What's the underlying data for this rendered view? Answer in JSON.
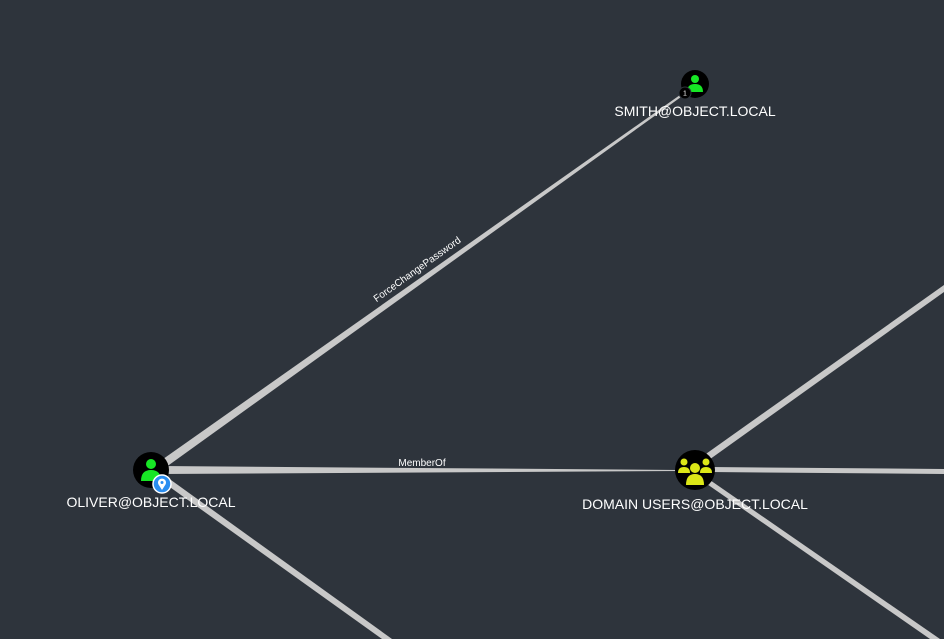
{
  "colors": {
    "background": "#2e343c",
    "edge": "#c8c8c8",
    "node_ring": "#000000",
    "user_icon": "#17e625",
    "group_icon": "#dbe617",
    "owned_marker": "#2b8ef0",
    "label": "#ffffff"
  },
  "nodes": {
    "smith": {
      "label": "SMITH@OBJECT.LOCAL",
      "type": "user",
      "icon": "user-icon",
      "badge": "1"
    },
    "oliver": {
      "label": "OLIVER@OBJECT.LOCAL",
      "type": "user",
      "icon": "user-icon",
      "marker": "map-pin-icon"
    },
    "domain_users": {
      "label": "DOMAIN USERS@OBJECT.LOCAL",
      "type": "group",
      "icon": "group-icon"
    }
  },
  "edges": {
    "force_change_password": {
      "label": "ForceChangePassword",
      "from": "OLIVER@OBJECT.LOCAL",
      "to": "SMITH@OBJECT.LOCAL"
    },
    "member_of": {
      "label": "MemberOf",
      "from": "OLIVER@OBJECT.LOCAL",
      "to": "DOMAIN USERS@OBJECT.LOCAL"
    }
  }
}
